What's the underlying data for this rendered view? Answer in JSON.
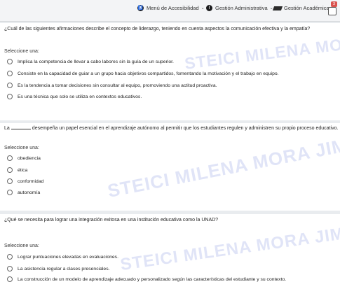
{
  "nav": {
    "accessibility_label": "Menú de Accesibilidad",
    "admin_label": "Gestión Administrativa",
    "academic_label": "Gestión Académica",
    "notification_count": "3"
  },
  "q1": {
    "question": "¿Cuál de las siguientes afirmaciones describe el concepto de liderazgo, teniendo en cuenta aspectos la comunicación efectiva y la empatía?",
    "prompt": "Seleccione una:",
    "options": [
      "Implica la competencia de llevar a cabo labores sin la guía de un superior.",
      "Consiste en la capacidad de guiar a un grupo hacia objetivos compartidos, fomentando la motivación y el trabajo en equipo.",
      "Es la tendencia a tomar decisiones sin consultar al equipo, promoviendo una actitud proactiva.",
      "Es una técnica que solo se utiliza en contextos educativos."
    ]
  },
  "q2": {
    "question_start": "La",
    "question_end": "desempeña un papel esencial en el aprendizaje autónomo al permitir que los estudiantes regulen y administren su propio proceso educativo.",
    "prompt": "Seleccione una:",
    "options": [
      "obediencia",
      "ética",
      "conformidad",
      "autonomía"
    ]
  },
  "q3": {
    "question": "¿Qué se necesita para lograr una integración exitosa en una institución educativa como la UNAD?",
    "prompt": "Seleccione una:",
    "options": [
      "Lograr puntuaciones elevadas en evaluaciones.",
      "La asistencia regular a clases presenciales.",
      "La construcción de un modelo de aprendizaje adecuado y personalizado según las características del estudiante y su contexto."
    ]
  },
  "watermarks": [
    "STEICI MILENA MORA JIMENEZ",
    "STEICI MILENA MORA JIMENEZ",
    "STEICI MILENA MORA JIMENEZ"
  ]
}
